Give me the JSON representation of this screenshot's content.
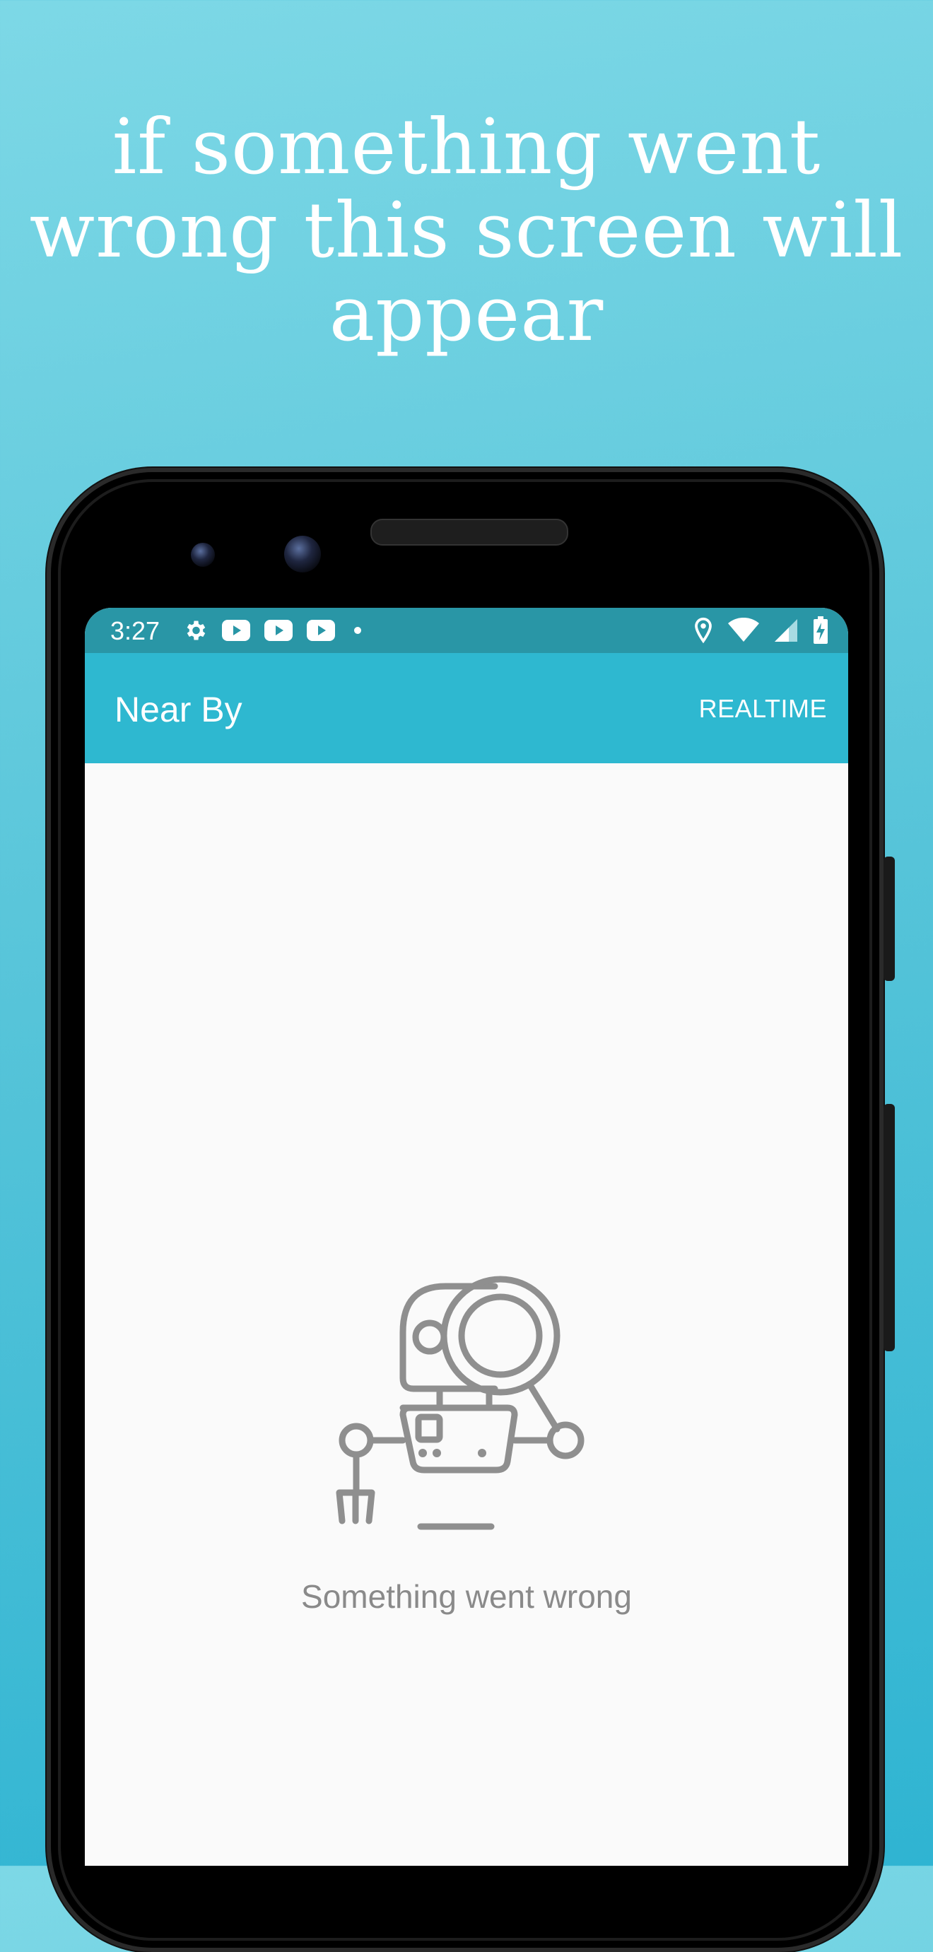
{
  "headline": {
    "line1": "if something went",
    "line2": "wrong this screen will",
    "line3": "appear"
  },
  "status_bar": {
    "time": "3:27",
    "left_icons": [
      "gear-icon",
      "youtube-icon",
      "youtube-icon",
      "youtube-icon",
      "dot-icon"
    ],
    "right_icons": [
      "location-icon",
      "wifi-icon",
      "signal-icon",
      "battery-charging-icon"
    ]
  },
  "app_bar": {
    "title": "Near By",
    "action_label": "REALTIME"
  },
  "empty_state": {
    "illustration": "robot-with-magnifier-icon",
    "message": "Something went wrong"
  },
  "colors": {
    "background_top": "#7dd8e6",
    "background_bottom": "#2fb4d2",
    "status_bar": "#2996a6",
    "app_bar": "#2eb8d0",
    "screen_bg": "#fafafa",
    "icon_gray": "#8f8f8f"
  }
}
